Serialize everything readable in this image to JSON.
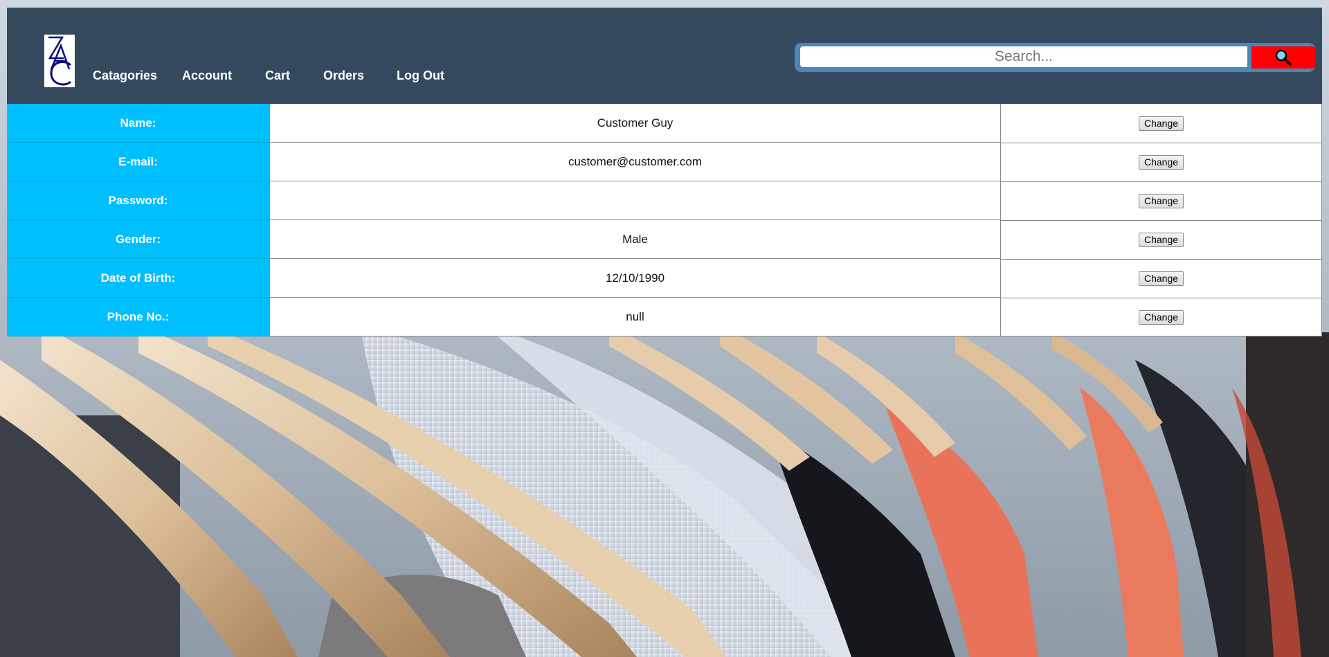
{
  "header": {
    "logo_text": "ZAC",
    "nav": [
      {
        "label": "Catagories"
      },
      {
        "label": "Account"
      },
      {
        "label": "Cart"
      },
      {
        "label": "Orders"
      },
      {
        "label": "Log Out"
      }
    ],
    "search": {
      "placeholder": "Search...",
      "value": "",
      "button_icon": "magnifier-icon"
    }
  },
  "account": {
    "rows": [
      {
        "label": "Name:",
        "value": "Customer Guy",
        "action": "Change"
      },
      {
        "label": "E-mail:",
        "value": "customer@customer.com",
        "action": "Change"
      },
      {
        "label": "Password:",
        "value": "",
        "action": "Change"
      },
      {
        "label": "Gender:",
        "value": "Male",
        "action": "Change"
      },
      {
        "label": "Date of Birth:",
        "value": "12/10/1990",
        "action": "Change"
      },
      {
        "label": "Phone No.:",
        "value": "null",
        "action": "Change"
      }
    ]
  },
  "colors": {
    "header_bg": "#34495e",
    "label_bg": "#00bfff",
    "search_button_bg": "#ff0000",
    "search_border": "#4a86b8"
  },
  "background": {
    "description_icon": "clothes-hangers-photo"
  }
}
